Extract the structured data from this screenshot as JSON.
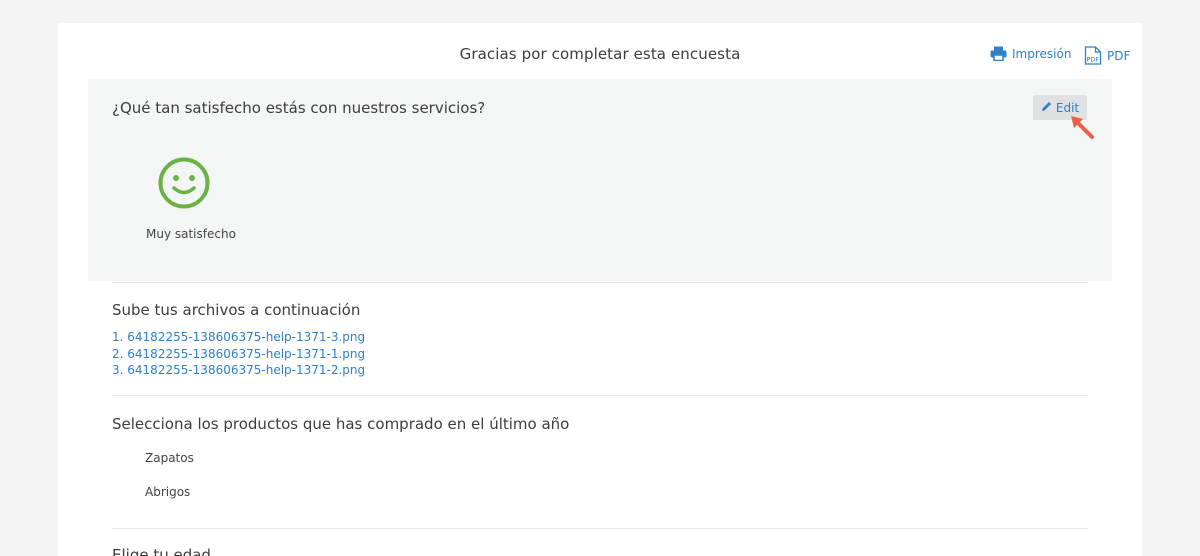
{
  "header": {
    "title": "Gracias por completar esta encuesta",
    "print_label": "Impresión",
    "pdf_label": "PDF"
  },
  "question1": {
    "title": "¿Qué tan satisfecho estás con nuestros servicios?",
    "edit_label": "Edit",
    "answer_icon": "smiley-face-icon",
    "answer_label": "Muy satisfecho"
  },
  "uploads": {
    "title": "Sube tus archivos a continuación",
    "files": [
      "1. 64182255-138606375-help-1371-3.png",
      "2. 64182255-138606375-help-1371-1.png",
      "3. 64182255-138606375-help-1371-2.png"
    ]
  },
  "products": {
    "title": "Selecciona los productos que has comprado en el último año",
    "items": [
      "Zapatos",
      "Abrigos"
    ]
  },
  "age": {
    "title": "Elige tu edad"
  },
  "colors": {
    "accent": "#2f80c9",
    "smiley": "#6ab245",
    "arrow": "#e8604a"
  }
}
